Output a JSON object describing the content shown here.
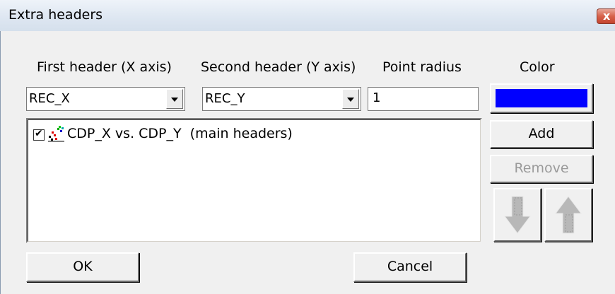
{
  "window": {
    "title": "Extra headers"
  },
  "labels": {
    "first_header": "First header (X axis)",
    "second_header": "Second header (Y axis)",
    "point_radius": "Point radius",
    "color": "Color"
  },
  "fields": {
    "first_header_value": "REC_X",
    "second_header_value": "REC_Y",
    "point_radius_value": "1",
    "color_value": "#0000ff"
  },
  "list": {
    "items": [
      {
        "checked": true,
        "label": "CDP_X vs. CDP_Y  (main headers)"
      }
    ]
  },
  "buttons": {
    "add": "Add",
    "remove": "Remove",
    "move_down_icon": "arrow-down-icon",
    "move_up_icon": "arrow-up-icon",
    "ok": "OK",
    "cancel": "Cancel",
    "close": "x"
  }
}
